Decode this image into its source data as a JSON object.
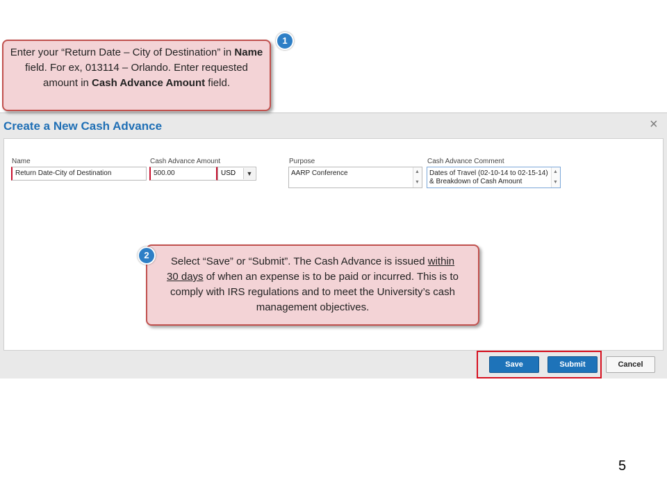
{
  "dialog": {
    "title": "Create a New Cash Advance",
    "close_label": "×",
    "fields": {
      "name": {
        "label": "Name",
        "value": "Return Date-City of Destination"
      },
      "amount": {
        "label": "Cash Advance Amount",
        "value": "500.00",
        "currency": "USD"
      },
      "purpose": {
        "label": "Purpose",
        "value": "AARP Conference"
      },
      "comment": {
        "label": "Cash Advance Comment",
        "value": "Dates of Travel (02-10-14 to 02-15-14) & Breakdown of Cash Amount"
      }
    },
    "buttons": {
      "save": "Save",
      "submit": "Submit",
      "cancel": "Cancel"
    },
    "colors": {
      "accent": "#1e73b9",
      "title": "#1f6fb5",
      "highlight": "#d6101f",
      "required": "#c8102e"
    }
  },
  "callouts": {
    "one": {
      "number": "1",
      "t1": "Enter your “Return Date – City of Destination” in ",
      "b1": "Name",
      "t2": " field.  For ex, 013114 – Orlando. Enter requested amount in ",
      "b2": "Cash Advance Amount",
      "t3": " field."
    },
    "two": {
      "number": "2",
      "t1": "Select “Save” or “Submit”. The Cash Advance is issued ",
      "u1": "within 30 days",
      "t2": " of when an expense is to be paid or incurred. This is to comply with IRS regulations and to meet the University’s cash management objectives."
    },
    "colors": {
      "fill": "#f3d3d6",
      "border": "#c0504d",
      "badge": "#2e7fc6"
    }
  },
  "icons": {
    "close": "close-icon",
    "select_arrow": "chevron-down-icon",
    "scroll_up": "scroll-up-icon",
    "scroll_down": "scroll-down-icon"
  },
  "page_number": "5"
}
